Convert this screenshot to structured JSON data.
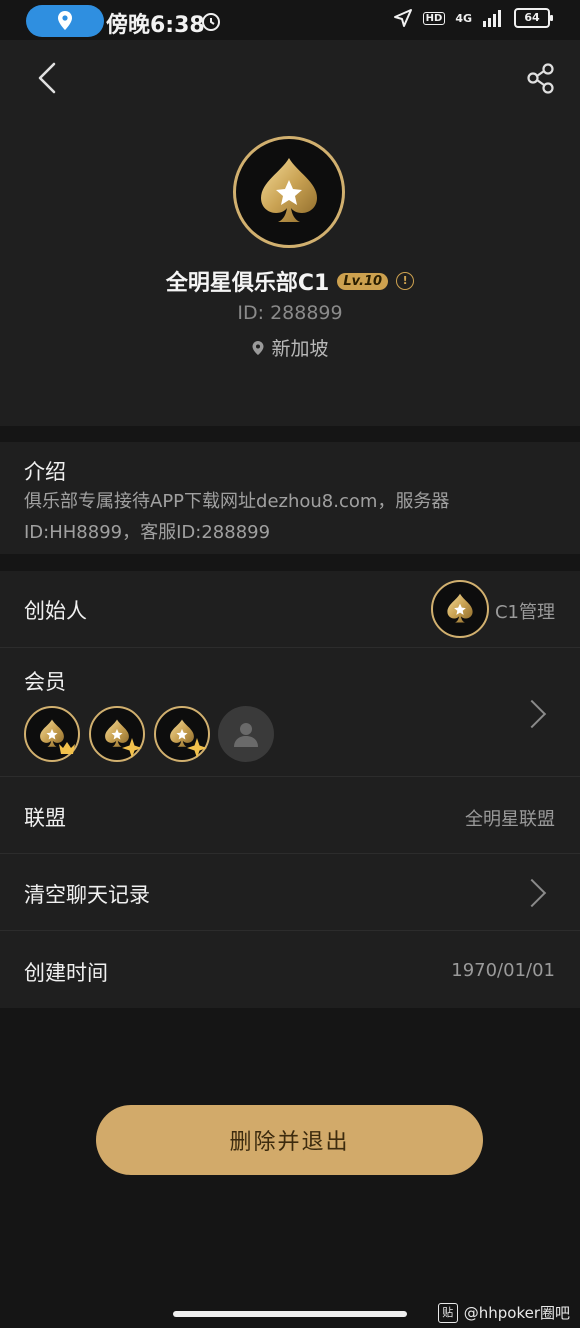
{
  "status_bar": {
    "time": "傍晚6:38",
    "network": "4G",
    "hd": "HD",
    "battery": "64"
  },
  "club": {
    "name": "全明星俱乐部C1",
    "level": "Lv.10",
    "id_text": "ID: 288899",
    "location": "新加坡"
  },
  "intro": {
    "title": "介绍",
    "text": "俱乐部专属接待APP下载网址dezhou8.com，服务器ID:HH8899，客服ID:288899"
  },
  "founder": {
    "label": "创始人",
    "name": "C1管理"
  },
  "members": {
    "label": "会员"
  },
  "alliance": {
    "label": "联盟",
    "value": "全明星联盟"
  },
  "clear_chat": {
    "label": "清空聊天记录"
  },
  "created": {
    "label": "创建时间",
    "value": "1970/01/01"
  },
  "actions": {
    "delete_exit": "删除并退出"
  },
  "watermark": {
    "logo": "贴",
    "text": "@hhpoker圈吧"
  },
  "icons": [
    "location-icon",
    "alarm-icon",
    "navigation-icon",
    "signal-icon",
    "battery-icon",
    "back-icon",
    "share-icon",
    "spade-star-icon",
    "info-icon",
    "map-pin-icon",
    "chevron-right-icon",
    "crown-icon",
    "sparkle-icon",
    "default-avatar-icon"
  ],
  "colors": {
    "accent": "#d2aa6a",
    "background": "#151515",
    "card": "#1f1f1f",
    "status_pill": "#2f8fe0"
  }
}
